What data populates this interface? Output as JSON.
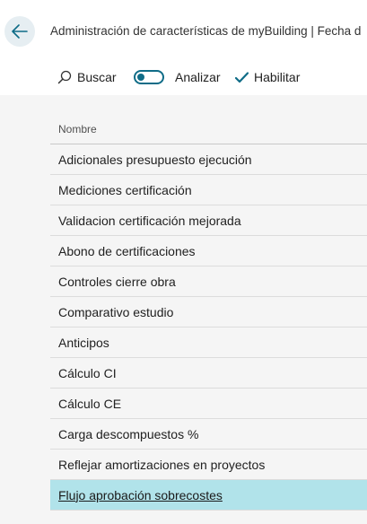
{
  "header": {
    "back_icon": "arrow-left-icon",
    "title": "Administración de características de myBuilding | Fecha d"
  },
  "toolbar": {
    "search_icon": "search-icon",
    "search_label": "Buscar",
    "analyze_toggle_on": false,
    "analyze_label": "Analizar",
    "enable_icon": "checkmark-icon",
    "enable_label": "Habilitar"
  },
  "table": {
    "column_header": "Nombre",
    "rows": [
      "Adicionales presupuesto ejecución",
      "Mediciones certificación",
      "Validacion certificación mejorada",
      "Abono de certificaciones",
      "Controles cierre obra",
      "Comparativo estudio",
      "Anticipos",
      "Cálculo CI",
      "Cálculo CE",
      "Carga descompuestos %",
      "Reflejar amortizaciones en proyectos",
      "Flujo aprobación sobrecostes"
    ],
    "selected_row": "Flujo aprobación sobrecostes"
  },
  "colors": {
    "accent": "#0f6c87",
    "selected_row_bg": "#b1e3ea",
    "back_button_bg": "#e6eef2"
  }
}
